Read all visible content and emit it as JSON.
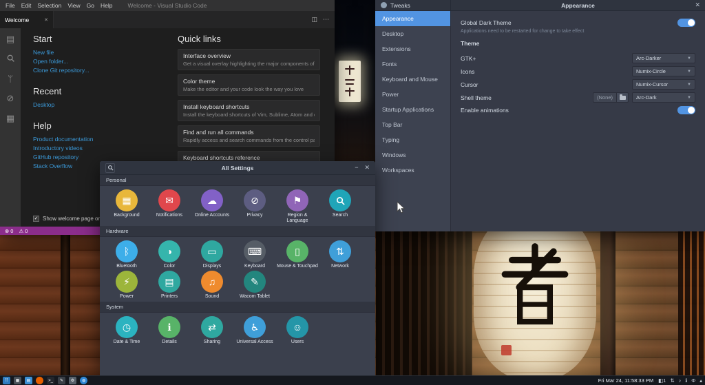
{
  "wallpaper": {
    "lantern_character": "者"
  },
  "vscode": {
    "window_title": "Welcome - Visual Studio Code",
    "menu": [
      "File",
      "Edit",
      "Selection",
      "View",
      "Go",
      "Help"
    ],
    "tab_label": "Welcome",
    "start_title": "Start",
    "start_links": [
      "New file",
      "Open folder...",
      "Clone Git repository..."
    ],
    "recent_title": "Recent",
    "recent_links": [
      "Desktop"
    ],
    "help_title": "Help",
    "help_links": [
      "Product documentation",
      "Introductory videos",
      "GitHub repository",
      "Stack Overflow"
    ],
    "quick_links_title": "Quick links",
    "cards": [
      {
        "title": "Interface overview",
        "desc": "Get a visual overlay highlighting the major components of th..."
      },
      {
        "title": "Color theme",
        "desc": "Make the editor and your code look the way you love"
      },
      {
        "title": "Install keyboard shortcuts",
        "desc": "Install the keyboard shortcuts of Vim, Sublime, Atom and oth..."
      },
      {
        "title": "Find and run all commands",
        "desc": "Rapidly access and search commands from the control pane..."
      },
      {
        "title": "Keyboard shortcuts reference",
        "desc": ""
      }
    ],
    "welcome_checkbox": "Show welcome page on startup",
    "status": {
      "error_icon": "⊗",
      "errors": "0",
      "warning_icon": "⚠",
      "warnings": "0"
    },
    "colors": {
      "statusbar": "#8b2d8b",
      "link": "#3b99d8"
    }
  },
  "tweaks": {
    "title": "Tweaks",
    "page_title": "Appearance",
    "sidebar": [
      "Appearance",
      "Desktop",
      "Extensions",
      "Fonts",
      "Keyboard and Mouse",
      "Power",
      "Startup Applications",
      "Top Bar",
      "Typing",
      "Windows",
      "Workspaces"
    ],
    "rows": {
      "global_dark_theme": {
        "label": "Global Dark Theme",
        "note": "Applications need to be restarted for change to take effect"
      },
      "theme_heading": "Theme",
      "gtk": {
        "label": "GTK+",
        "value": "Arc-Darker"
      },
      "icons": {
        "label": "Icons",
        "value": "Numix-Circle"
      },
      "cursor": {
        "label": "Cursor",
        "value": "Numix-Cursor"
      },
      "shell": {
        "label": "Shell theme",
        "none_value": "(None)",
        "value": "Arc-Dark"
      },
      "animations": {
        "label": "Enable animations"
      }
    },
    "accent": "#5294e2"
  },
  "settings": {
    "title": "All Settings",
    "minimize_glyph": "−",
    "close_glyph": "✕",
    "sections": [
      {
        "name": "Personal",
        "items": [
          {
            "label": "Background",
            "glyph": "▦",
            "color": "#e8b73b"
          },
          {
            "label": "Notifications",
            "glyph": "✉",
            "color": "#e0474c"
          },
          {
            "label": "Online Accounts",
            "glyph": "☁",
            "color": "#8261c7"
          },
          {
            "label": "Privacy",
            "glyph": "⊘",
            "color": "#5d5d81"
          },
          {
            "label": "Region & Language",
            "glyph": "⚑",
            "color": "#9065b7"
          },
          {
            "label": "Search",
            "icon": "magnifier",
            "color": "#20a5b8"
          }
        ]
      },
      {
        "name": "Hardware",
        "items": [
          {
            "label": "Bluetooth",
            "glyph": "ᛒ",
            "color": "#3daee9"
          },
          {
            "label": "Color",
            "glyph": "◑",
            "color": "#35b5ac"
          },
          {
            "label": "Displays",
            "glyph": "▭",
            "color": "#2fa8a0"
          },
          {
            "label": "Keyboard",
            "glyph": "⌨",
            "color": "#565d66"
          },
          {
            "label": "Mouse & Touchpad",
            "glyph": "▯",
            "color": "#58b368"
          },
          {
            "label": "Network",
            "glyph": "⇅",
            "color": "#3f9fd9"
          },
          {
            "label": "Power",
            "glyph": "⚡",
            "color": "#9cb53b"
          },
          {
            "label": "Printers",
            "glyph": "▤",
            "color": "#2fa8a0"
          },
          {
            "label": "Sound",
            "glyph": "♫",
            "color": "#ef8b2e"
          },
          {
            "label": "Wacom Tablet",
            "glyph": "✎",
            "color": "#23867e"
          }
        ]
      },
      {
        "name": "System",
        "items": [
          {
            "label": "Date & Time",
            "glyph": "◷",
            "color": "#2bb3c0"
          },
          {
            "label": "Details",
            "glyph": "ℹ",
            "color": "#58b368"
          },
          {
            "label": "Sharing",
            "glyph": "⇄",
            "color": "#2fa8a0"
          },
          {
            "label": "Universal Access",
            "glyph": "♿",
            "color": "#3f9fd9"
          },
          {
            "label": "Users",
            "glyph": "☺",
            "color": "#2496a8"
          }
        ]
      }
    ]
  },
  "taskbar": {
    "launchers": [
      {
        "name": "app-launcher",
        "glyph": "⠿",
        "color": "#2e7bbf"
      },
      {
        "name": "desktop-pager",
        "glyph": "▦",
        "color": "#4a5159"
      },
      {
        "name": "file-manager",
        "glyph": "▤",
        "color": "#3b8fd4"
      },
      {
        "name": "firefox",
        "glyph": "",
        "color": "#e66000"
      },
      {
        "name": "terminal",
        "glyph": ">_",
        "color": "#23262c"
      },
      {
        "name": "text-editor",
        "glyph": "✎",
        "color": "#3a3f46"
      },
      {
        "name": "system-settings",
        "glyph": "⚙",
        "color": "#57606a"
      },
      {
        "name": "web-browser",
        "glyph": "◍",
        "color": "#2e86d4"
      }
    ],
    "clock": "Fri Mar 24, 11:58:33 PM",
    "tray": [
      {
        "name": "window-badge",
        "glyph": "◧1"
      },
      {
        "name": "network",
        "glyph": "⇅"
      },
      {
        "name": "volume",
        "glyph": "♪"
      },
      {
        "name": "notifications",
        "glyph": "ℹ"
      },
      {
        "name": "power",
        "glyph": "Φ"
      },
      {
        "name": "panel-expand",
        "glyph": "▴"
      }
    ]
  }
}
